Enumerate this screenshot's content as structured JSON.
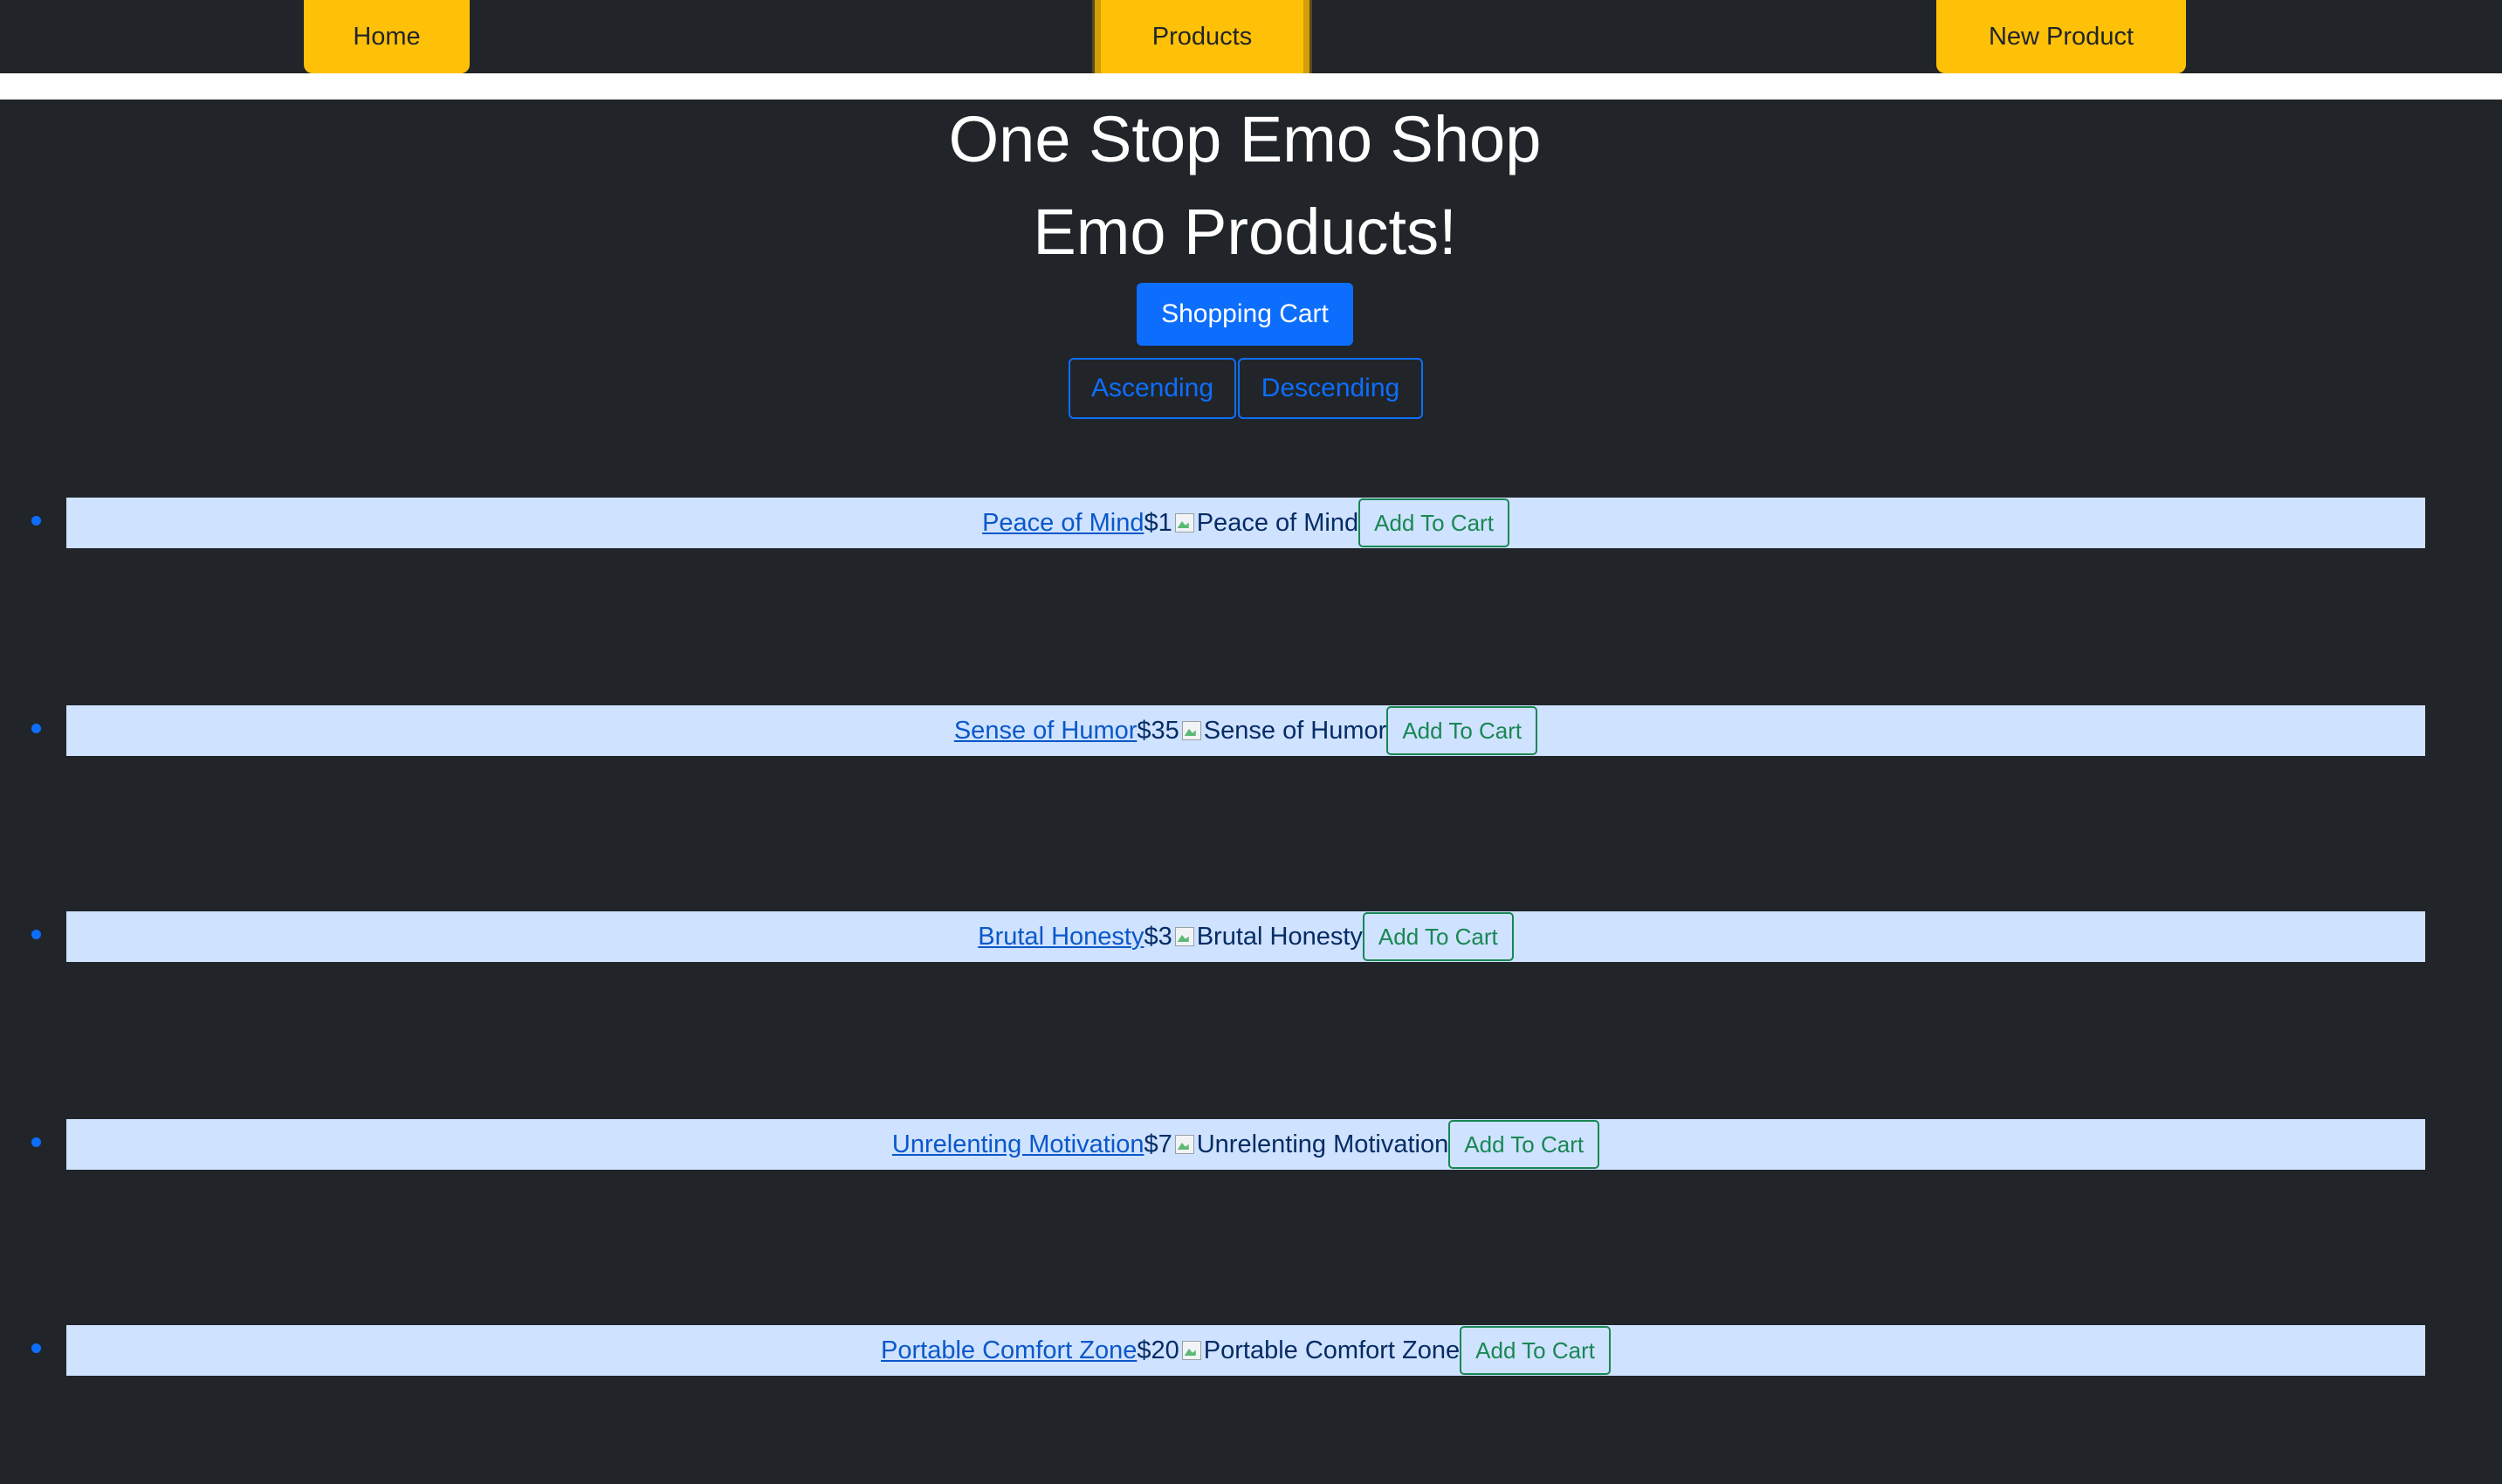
{
  "nav": {
    "home_label": "Home",
    "products_label": "Products",
    "new_product_label": "New Product"
  },
  "header": {
    "title": "One Stop Emo Shop",
    "subtitle": "Emo Products!"
  },
  "actions": {
    "cart_label": "Shopping Cart",
    "ascending_label": "Ascending",
    "descending_label": "Descending"
  },
  "products": [
    {
      "name": "Peace of Mind",
      "price": "$1",
      "image_alt": "Peace of Mind",
      "button": "Add To Cart"
    },
    {
      "name": "Sense of Humor",
      "price": "$35",
      "image_alt": "Sense of Humor",
      "button": "Add To Cart"
    },
    {
      "name": "Brutal Honesty",
      "price": "$3",
      "image_alt": "Brutal Honesty",
      "button": "Add To Cart"
    },
    {
      "name": "Unrelenting Motivation",
      "price": "$7",
      "image_alt": "Unrelenting Motivation",
      "button": "Add To Cart"
    },
    {
      "name": "Portable Comfort Zone",
      "price": "$20",
      "image_alt": "Portable Comfort Zone",
      "button": "Add To Cart"
    }
  ],
  "colors": {
    "background": "#212529",
    "nav_button": "#ffc107",
    "primary": "#0d6efd",
    "row_background": "#cfe2ff",
    "success": "#198754"
  }
}
